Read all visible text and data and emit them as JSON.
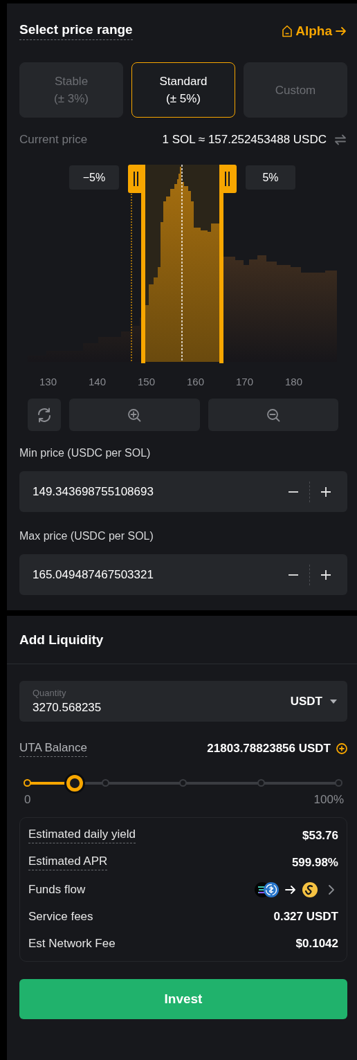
{
  "price_range": {
    "title": "Select price range",
    "link": {
      "label": "Alpha"
    },
    "presets": [
      {
        "label": "Stable",
        "sublabel": "(± 3%)",
        "selected": false
      },
      {
        "label": "Standard",
        "sublabel": "(± 5%)",
        "selected": true
      },
      {
        "label": "Custom",
        "selected": false
      }
    ],
    "current_price": {
      "label": "Current price",
      "value": "1 SOL ≈ 157.252453488 USDC"
    },
    "chart": {
      "lower_tag": "−5%",
      "upper_tag": "5%",
      "axis_labels": [
        "130",
        "140",
        "150",
        "160",
        "170",
        "180"
      ]
    },
    "min_price": {
      "label": "Min price (USDC per SOL)",
      "value": "149.343698755108693"
    },
    "max_price": {
      "label": "Max price (USDC per SOL)",
      "value": "165.049487467503321"
    }
  },
  "add_liquidity": {
    "title": "Add Liquidity",
    "quantity": {
      "label": "Quantity",
      "value": "3270.568235",
      "currency": "USDT"
    },
    "balance": {
      "label": "UTA Balance",
      "value": "21803.78823856 USDT"
    },
    "slider": {
      "level": 0.15,
      "min_label": "0",
      "max_label": "100%"
    },
    "summary": [
      {
        "label": "Estimated daily yield",
        "value": "$53.76",
        "kind": "tooltip"
      },
      {
        "label": "Estimated APR",
        "value": "599.98%",
        "kind": "tooltip"
      },
      {
        "label": "Funds flow",
        "kind": "flow"
      },
      {
        "label": "Service fees",
        "value": "0.327 USDT",
        "kind": "plain"
      },
      {
        "label": "Est Network Fee",
        "value": "$0.1042",
        "kind": "plain"
      }
    ],
    "button": "Invest"
  }
}
